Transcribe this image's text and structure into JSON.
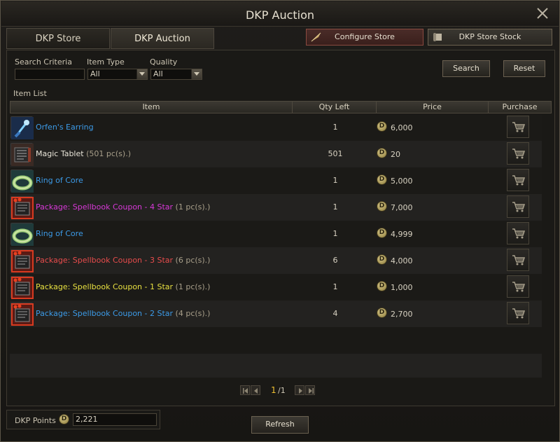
{
  "window": {
    "title": "DKP Auction"
  },
  "tabs": [
    {
      "label": "DKP Store"
    },
    {
      "label": "DKP Auction"
    }
  ],
  "topbar": {
    "configure_label": "Configure Store",
    "stock_label": "DKP Store Stock"
  },
  "search": {
    "criteria_label": "Search Criteria",
    "criteria_value": "",
    "item_type_label": "Item Type",
    "item_type_value": "All",
    "quality_label": "Quality",
    "quality_value": "All",
    "search_label": "Search",
    "reset_label": "Reset"
  },
  "list": {
    "title": "Item List",
    "columns": {
      "item": "Item",
      "qty": "Qty Left",
      "price": "Price",
      "purchase": "Purchase"
    },
    "rows": [
      {
        "name": "Orfen's Earring",
        "count": "",
        "name_color": "#3c9be8",
        "icon": "earring-icon",
        "qty": "1",
        "price": "6,000"
      },
      {
        "name": "Magic Tablet",
        "count": "(501 pc(s).)",
        "name_color": "#e8e4d8",
        "icon": "tablet-icon",
        "qty": "501",
        "price": "20"
      },
      {
        "name": "Ring of Core",
        "count": "",
        "name_color": "#3c9be8",
        "icon": "ring-icon",
        "qty": "1",
        "price": "5,000"
      },
      {
        "name": "Package: Spellbook Coupon - 4 Star",
        "count": "(1 pc(s).)",
        "name_color": "#d838d8",
        "icon": "spellbook-package-icon",
        "qty": "1",
        "price": "7,000"
      },
      {
        "name": "Ring of Core",
        "count": "",
        "name_color": "#3c9be8",
        "icon": "ring-icon",
        "qty": "1",
        "price": "4,999"
      },
      {
        "name": "Package: Spellbook Coupon - 3 Star",
        "count": "(6 pc(s).)",
        "name_color": "#e84c4c",
        "icon": "spellbook-package-icon",
        "qty": "6",
        "price": "4,000"
      },
      {
        "name": "Package: Spellbook Coupon - 1 Star",
        "count": "(1 pc(s).)",
        "name_color": "#e8e040",
        "icon": "spellbook-package-icon",
        "qty": "1",
        "price": "1,000"
      },
      {
        "name": "Package: Spellbook Coupon - 2 Star",
        "count": "(4 pc(s).)",
        "name_color": "#3c9be8",
        "icon": "spellbook-package-icon",
        "qty": "4",
        "price": "2,700"
      }
    ],
    "coin_glyph": "D"
  },
  "pagination": {
    "current": "1",
    "total": "/1"
  },
  "footer": {
    "points_label": "DKP Points",
    "points_value": "2,221",
    "refresh_label": "Refresh"
  },
  "colors": {
    "accent_current_page": "#f0c030",
    "configure_bg": "#4a2c28"
  }
}
